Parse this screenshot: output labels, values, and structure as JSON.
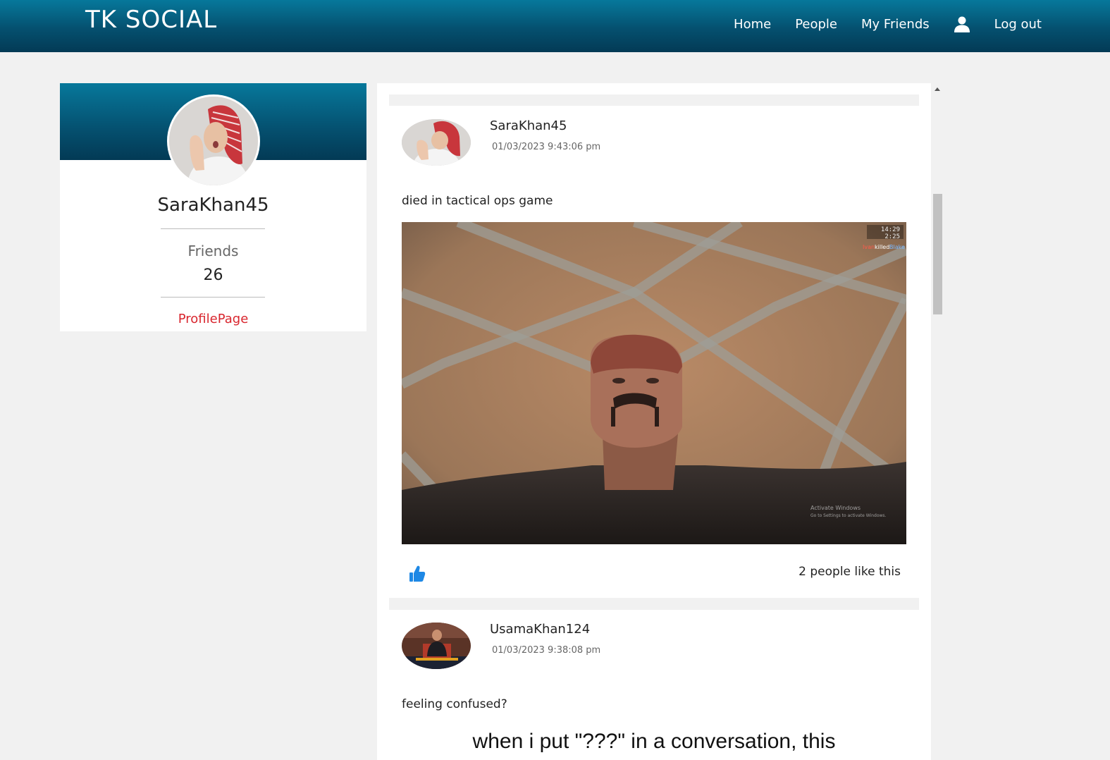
{
  "navbar": {
    "brand": "TK SOCIAL",
    "links": [
      "Home",
      "People",
      "My Friends"
    ],
    "user_icon": "user-icon",
    "logout": "Log out"
  },
  "profile": {
    "username": "SaraKhan45",
    "friends_label": "Friends",
    "friends_count": "26",
    "profile_link": "ProfilePage"
  },
  "posts": [
    {
      "username": "SaraKhan45",
      "timestamp": "01/03/2023 9:43:06 pm",
      "text": "died in tactical ops game",
      "likes": "2 people like this",
      "image": {
        "hud_time": "14:29",
        "hud_score": "2:25",
        "kill_feed": [
          "Ivan",
          "killed",
          "Blake"
        ],
        "watermark_line1": "Activate Windows",
        "watermark_line2": "Go to Settings to activate Windows."
      }
    },
    {
      "username": "UsamaKhan124",
      "timestamp": "01/03/2023 9:38:08 pm",
      "text": "feeling confused?",
      "meme_text": "when i put \"???\" in a conversation, this"
    }
  ],
  "colors": {
    "nav_gradient_top": "#06789b",
    "nav_gradient_bottom": "#033a55",
    "link_red": "#d9262e",
    "like_blue": "#1e88e5",
    "background": "#f1f1f1"
  }
}
